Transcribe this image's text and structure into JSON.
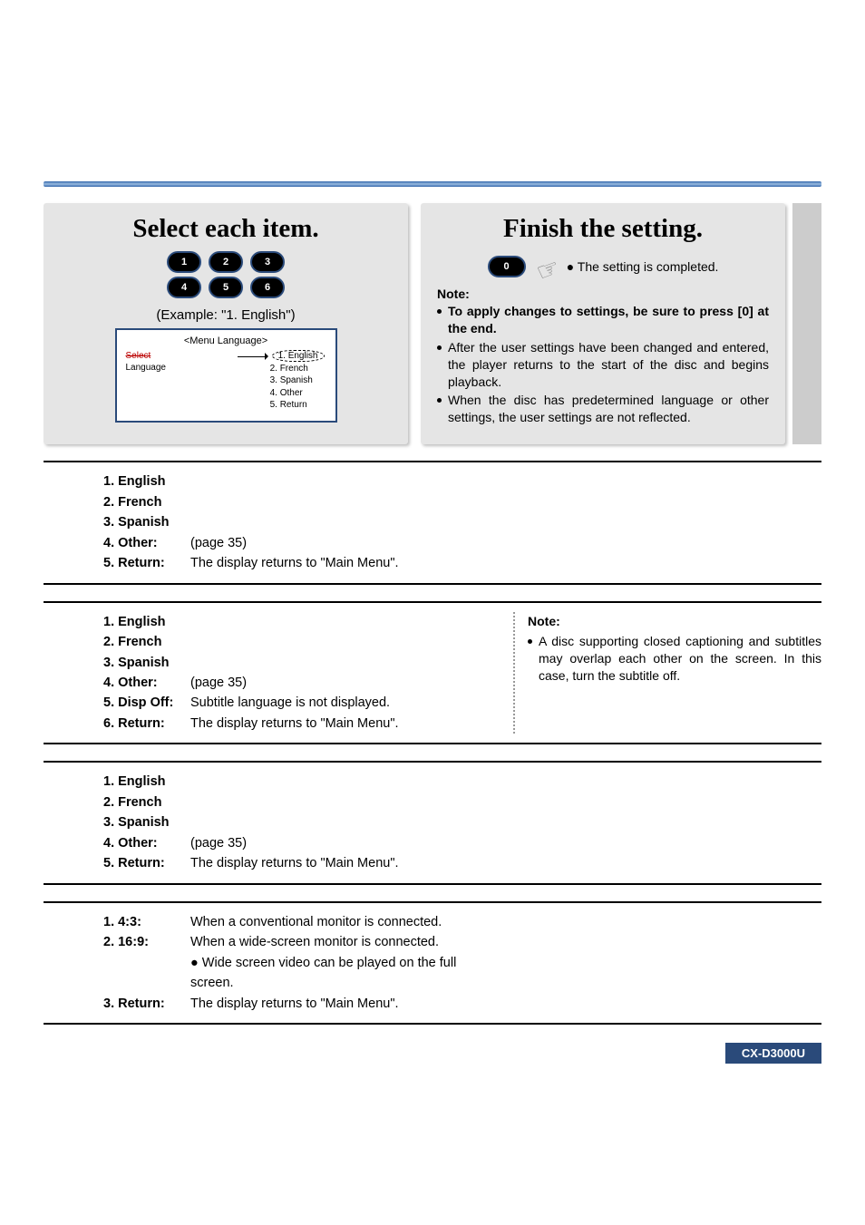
{
  "step2": {
    "title": "Select each item.",
    "remote": {
      "r1": [
        "1",
        "2",
        "3"
      ],
      "r2": [
        "4",
        "5",
        "6"
      ]
    },
    "example": "(Example: \"1. English\")",
    "osd": {
      "title": "<Menu Language>",
      "left_strike": "Select",
      "left2": "Language",
      "items": [
        "1. English",
        "2. French",
        "3. Spanish",
        "4. Other",
        "5. Return"
      ]
    }
  },
  "step3": {
    "title": "Finish the setting.",
    "zero_label": "0",
    "completed": "The setting is completed.",
    "note_label": "Note:",
    "bullets": [
      {
        "text": "To apply changes to settings, be sure to press [0] at the end.",
        "bold": true
      },
      {
        "text": "After the user settings have been changed and entered, the player returns to the start of the disc and begins playback.",
        "bold": false
      },
      {
        "text": "When the disc has predetermined language or other settings, the user settings are not reflected.",
        "bold": false
      }
    ]
  },
  "sec1": {
    "rows": [
      {
        "label": "1. English",
        "desc": ""
      },
      {
        "label": "2. French",
        "desc": ""
      },
      {
        "label": "3. Spanish",
        "desc": ""
      },
      {
        "label": "4. Other:",
        "desc": "(page 35)"
      },
      {
        "label": "5. Return:",
        "desc": "The display returns to \"Main Menu\"."
      }
    ]
  },
  "sec2": {
    "rows": [
      {
        "label": "1. English",
        "desc": ""
      },
      {
        "label": "2. French",
        "desc": ""
      },
      {
        "label": "3. Spanish",
        "desc": ""
      },
      {
        "label": "4. Other:",
        "desc": "(page 35)"
      },
      {
        "label": "5. Disp Off:",
        "desc": "Subtitle language is not displayed."
      },
      {
        "label": "6. Return:",
        "desc": "The display returns to \"Main Menu\"."
      }
    ],
    "note_label": "Note:",
    "note_bullet": "A disc supporting closed captioning and subtitles may overlap each other on the screen. In this case, turn the subtitle off."
  },
  "sec3": {
    "rows": [
      {
        "label": "1. English",
        "desc": ""
      },
      {
        "label": "2. French",
        "desc": ""
      },
      {
        "label": "3. Spanish",
        "desc": ""
      },
      {
        "label": "4. Other:",
        "desc": "(page 35)"
      },
      {
        "label": "5. Return:",
        "desc": "The display returns to \"Main Menu\"."
      }
    ]
  },
  "sec4": {
    "rows": [
      {
        "label": "1. 4:3:",
        "desc": "When a conventional monitor is connected."
      },
      {
        "label": "2. 16:9:",
        "desc": "When a wide-screen monitor is connected."
      },
      {
        "label": "",
        "desc": "● Wide screen video can be played on the full screen.",
        "sub": true
      },
      {
        "label": "3. Return:",
        "desc": "The display returns to \"Main Menu\"."
      }
    ]
  },
  "footer": {
    "model": "CX-D3000U"
  }
}
